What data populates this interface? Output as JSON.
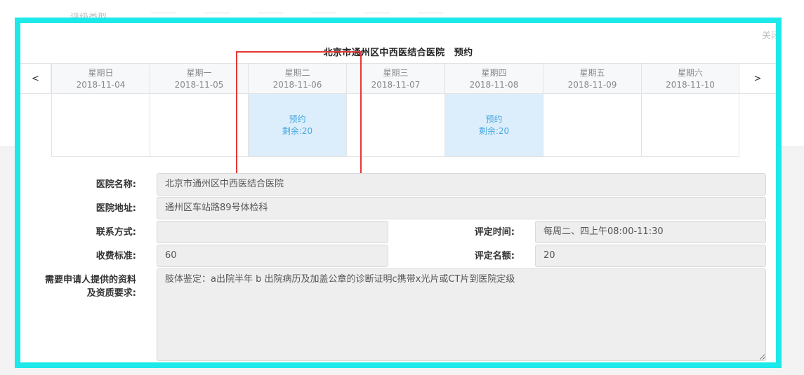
{
  "background": {
    "filter_label": "评级类型"
  },
  "modal": {
    "close_label": "关闭",
    "title": "北京市通州区中西医结合医院　预约"
  },
  "calendar": {
    "prev_label": "<",
    "next_label": ">",
    "days": [
      {
        "weekday": "星期日",
        "date": "2018-11-04",
        "available": false
      },
      {
        "weekday": "星期一",
        "date": "2018-11-05",
        "available": false
      },
      {
        "weekday": "星期二",
        "date": "2018-11-06",
        "available": true,
        "action": "预约",
        "remaining": "剩余:20"
      },
      {
        "weekday": "星期三",
        "date": "2018-11-07",
        "available": false
      },
      {
        "weekday": "星期四",
        "date": "2018-11-08",
        "available": true,
        "action": "预约",
        "remaining": "剩余:20"
      },
      {
        "weekday": "星期五",
        "date": "2018-11-09",
        "available": false
      },
      {
        "weekday": "星期六",
        "date": "2018-11-10",
        "available": false
      }
    ]
  },
  "form": {
    "hospital_name_label": "医院名称:",
    "hospital_name_value": "北京市通州区中西医结合医院",
    "hospital_address_label": "医院地址:",
    "hospital_address_value": "通州区车站路89号体检科",
    "contact_label": "联系方式:",
    "contact_value": "",
    "eval_time_label": "评定时间:",
    "eval_time_value": "每周二、四上午08:00-11:30",
    "fee_label": "收费标准:",
    "fee_value": "60",
    "eval_quota_label": "评定名额:",
    "eval_quota_value": "20",
    "requirements_label_line1": "需要申请人提供的资料",
    "requirements_label_line2": "及资质要求:",
    "requirements_value": "肢体鉴定：a出院半年 b 出院病历及加盖公章的诊断证明c携带x光片或CT片到医院定级"
  },
  "colors": {
    "frame": "#1de9ea",
    "highlight": "#e53935",
    "available_bg": "#dceefb",
    "available_text": "#4aa8e0"
  }
}
